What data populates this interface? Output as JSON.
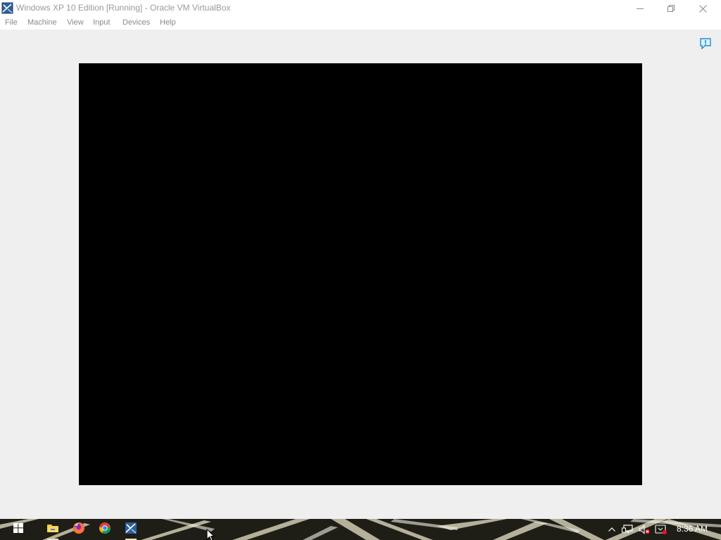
{
  "window": {
    "title": "Windows XP 10 Edition [Running] - Oracle VM VirtualBox",
    "app_icon": "virtualbox-icon",
    "controls": [
      "minimize-icon",
      "restore-icon",
      "close-icon"
    ]
  },
  "menubar": {
    "items": [
      {
        "label": "File"
      },
      {
        "label": "Machine"
      },
      {
        "label": "View"
      },
      {
        "label": "Input"
      },
      {
        "label": "Devices"
      },
      {
        "label": "Help"
      }
    ]
  },
  "content": {
    "notification_icon": "notification-icon",
    "vm_screen_state": "black"
  },
  "taskbar": {
    "pinned": [
      {
        "icon": "windows-start-icon",
        "active": false
      },
      {
        "icon": "file-explorer-icon",
        "active": true
      },
      {
        "icon": "firefox-icon",
        "active": false
      },
      {
        "icon": "chrome-icon",
        "active": false
      },
      {
        "icon": "virtualbox-icon",
        "active": true
      }
    ],
    "tray": {
      "icons": [
        "chevron-up-icon",
        "network-icon",
        "volume-muted-icon",
        "action-center-icon"
      ],
      "clock": "8:36 AM"
    }
  },
  "colors": {
    "titlebar_bg": "#ffffff",
    "client_bg": "#efefef",
    "vm_screen": "#000000",
    "taskbar_bg": "#1e1d16",
    "accent_blue": "#1e8fd6"
  }
}
